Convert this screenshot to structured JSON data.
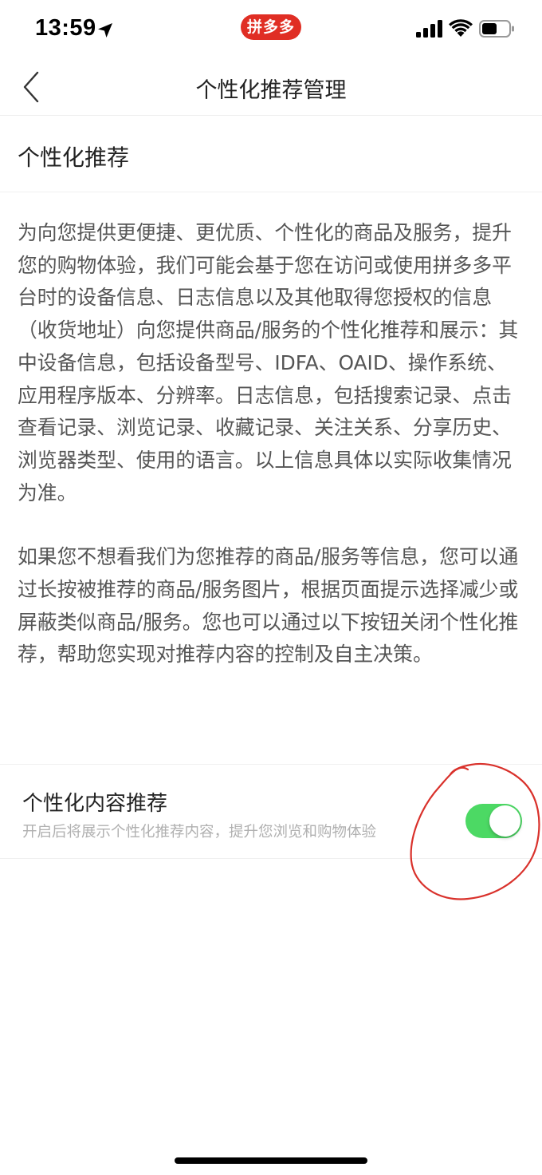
{
  "status_bar": {
    "time": "13:59",
    "app_badge": "拼多多",
    "icons": [
      "location-arrow-icon",
      "cellular-signal-icon",
      "wifi-icon",
      "battery-icon"
    ]
  },
  "nav": {
    "title": "个性化推荐管理",
    "back_icon": "chevron-left-icon"
  },
  "section": {
    "heading": "个性化推荐"
  },
  "description": {
    "paragraph1": "为向您提供更便捷、更优质、个性化的商品及服务，提升您的购物体验，我们可能会基于您在访问或使用拼多多平台时的设备信息、日志信息以及其他取得您授权的信息（收货地址）向您提供商品/服务的个性化推荐和展示：其中设备信息，包括设备型号、IDFA、OAID、操作系统、应用程序版本、分辨率。日志信息，包括搜索记录、点击查看记录、浏览记录、收藏记录、关注关系、分享历史、浏览器类型、使用的语言。以上信息具体以实际收集情况为准。",
    "paragraph2": "如果您不想看我们为您推荐的商品/服务等信息，您可以通过长按被推荐的商品/服务图片，根据页面提示选择减少或屏蔽类似商品/服务。您也可以通过以下按钮关闭个性化推荐，帮助您实现对推荐内容的控制及自主决策。"
  },
  "setting": {
    "title": "个性化内容推荐",
    "subtitle": "开启后将展示个性化推荐内容，提升您浏览和购物体验",
    "enabled": true
  },
  "colors": {
    "toggle_on": "#4cd964",
    "brand_red": "#e02e24",
    "annotation_red": "#d9312b"
  }
}
